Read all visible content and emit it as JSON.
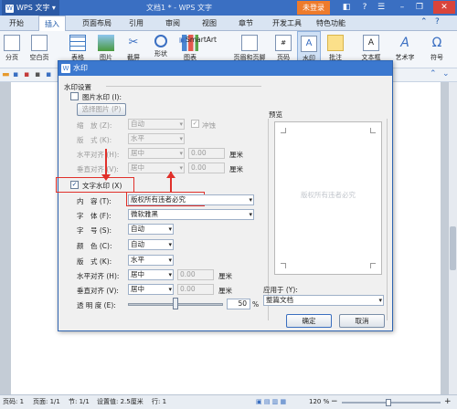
{
  "titlebar": {
    "app_name": "WPS 文字",
    "doc_title": "文档1 * - WPS 文字",
    "login": "未登录",
    "min": "–",
    "restore": "❐",
    "close": "✕"
  },
  "tabs": [
    "开始",
    "插入",
    "页面布局",
    "引用",
    "审阅",
    "视图",
    "章节",
    "开发工具",
    "特色功能"
  ],
  "ribbon": [
    "分页",
    "空白页",
    "表格",
    "图片",
    "截屏",
    "形状",
    "图表",
    "SmartArt",
    "页眉和页脚",
    "页码",
    "水印",
    "批注",
    "文本框",
    "艺术字",
    "符号"
  ],
  "dialog": {
    "title": "水印",
    "group": "水印设置",
    "pic_watermark": "图片水印 (I):",
    "choose_pic": "选择图片 (P)",
    "scale_label": "缩　放 (Z):",
    "scale_value": "自动",
    "washout_label": "冲蚀",
    "pic_layout_label": "版　式 (K):",
    "pic_layout_value": "水平",
    "pic_halign_label": "水平对齐 (H):",
    "pic_halign_value": "居中",
    "pic_halign_num": "0.00",
    "pic_valign_label": "垂直对齐 (V):",
    "pic_valign_value": "居中",
    "pic_valign_num": "0.00",
    "unit": "厘米",
    "text_watermark": "文字水印 (X)",
    "content_label": "内　容 (T):",
    "content_value": "版权所有违者必究",
    "font_label": "字　体 (F):",
    "font_value": "微软雅黑",
    "size_label": "字　号 (S):",
    "size_value": "自动",
    "color_label": "颜　色 (C):",
    "color_value": "自动",
    "layout_label": "版　式 (K):",
    "layout_value": "水平",
    "halign_label": "水平对齐 (H):",
    "halign_value": "居中",
    "halign_num": "0.00",
    "valign_label": "垂直对齐 (V):",
    "valign_value": "居中",
    "valign_num": "0.00",
    "transparency_label": "透 明 度 (E):",
    "transparency_value": "50",
    "transparency_level": 0.5,
    "percent": "%",
    "preview_label": "预览",
    "preview_text": "版权所有违者必究",
    "apply_label": "应用于 (Y):",
    "apply_value": "整篇文档",
    "ok": "确定",
    "cancel": "取消"
  },
  "status": {
    "page": "页码: 1",
    "pages": "页面: 1/1",
    "section": "节: 1/1",
    "setting": "设置值: 2.5厘米",
    "row": "行: 1",
    "zoom": "120 %"
  },
  "colors": {
    "titlebar": "#3a6fc2",
    "login": "#ee7b2c",
    "highlight": "#e0302a"
  }
}
